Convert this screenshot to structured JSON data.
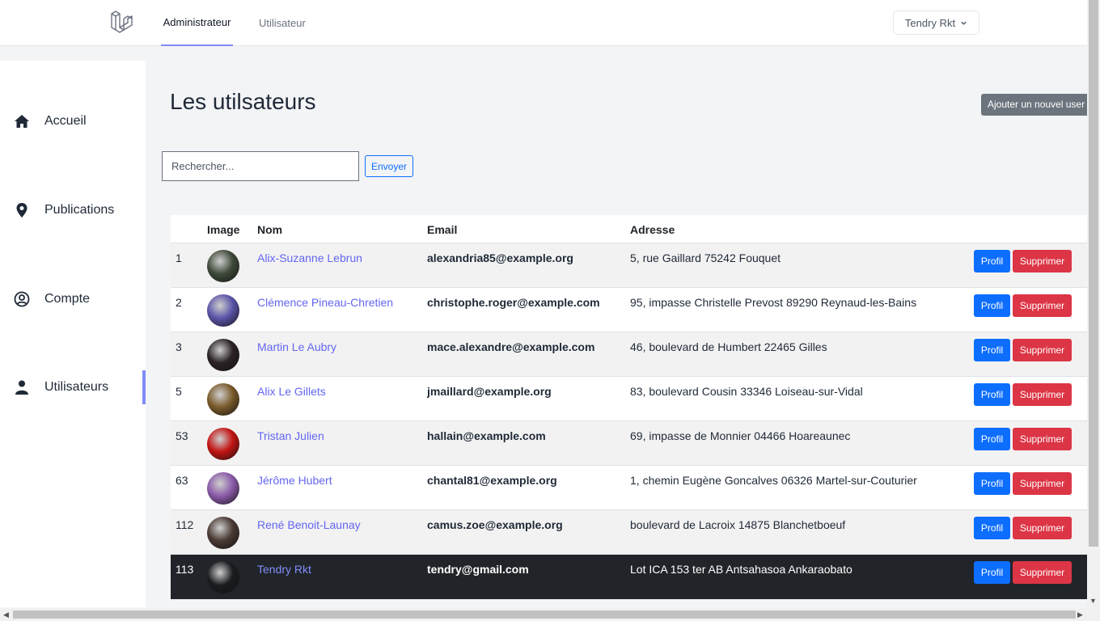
{
  "topnav": {
    "tabs": [
      {
        "label": "Administrateur",
        "active": true
      },
      {
        "label": "Utilisateur",
        "active": false
      }
    ],
    "user_menu": "Tendry Rkt"
  },
  "sidebar": {
    "items": [
      {
        "label": "Accueil",
        "icon": "home-icon"
      },
      {
        "label": "Publications",
        "icon": "map-pin-icon"
      },
      {
        "label": "Compte",
        "icon": "user-circle-icon"
      },
      {
        "label": "Utilisateurs",
        "icon": "user-icon",
        "active": true
      }
    ]
  },
  "main": {
    "title": "Les utilsateurs",
    "add_button": "Ajouter un nouvel user",
    "search_placeholder": "Rechercher...",
    "send_button": "Envoyer"
  },
  "table": {
    "headers": [
      "",
      "Image",
      "Nom",
      "Email",
      "Adresse"
    ],
    "profile_label": "Profil",
    "delete_label": "Supprimer",
    "rows": [
      {
        "id": "1",
        "name": "Alix-Suzanne Lebrun",
        "email": "alexandria85@example.org",
        "address": "5, rue Gaillard 75242 Fouquet",
        "avatar": "#3f4a3a"
      },
      {
        "id": "2",
        "name": "Clémence Pineau-Chretien",
        "email": "christophe.roger@example.com",
        "address": "95, impasse Christelle Prevost 89290 Reynaud-les-Bains",
        "avatar": "#5b54a8"
      },
      {
        "id": "3",
        "name": "Martin Le Aubry",
        "email": "mace.alexandre@example.com",
        "address": "46, boulevard de Humbert 22465 Gilles",
        "avatar": "#2a2226"
      },
      {
        "id": "5",
        "name": "Alix Le Gillets",
        "email": "jmaillard@example.org",
        "address": "83, boulevard Cousin 33346 Loiseau-sur-Vidal",
        "avatar": "#7a5a2a"
      },
      {
        "id": "53",
        "name": "Tristan Julien",
        "email": "hallain@example.com",
        "address": "69, impasse de Monnier 04466 Hoareaunec",
        "avatar": "#c41414"
      },
      {
        "id": "63",
        "name": "Jérôme Hubert",
        "email": "chantal81@example.org",
        "address": "1, chemin Eugène Goncalves 06326 Martel-sur-Couturier",
        "avatar": "#8a5aa8"
      },
      {
        "id": "112",
        "name": "René Benoit-Launay",
        "email": "camus.zoe@example.org",
        "address": "boulevard de Lacroix 14875 Blanchetboeuf",
        "avatar": "#4a3a34"
      },
      {
        "id": "113",
        "name": "Tendry Rkt",
        "email": "tendry@gmail.com",
        "address": "Lot ICA 153 ter AB Antsahasoa Ankaraobato",
        "avatar": "#1a1d20"
      }
    ]
  }
}
